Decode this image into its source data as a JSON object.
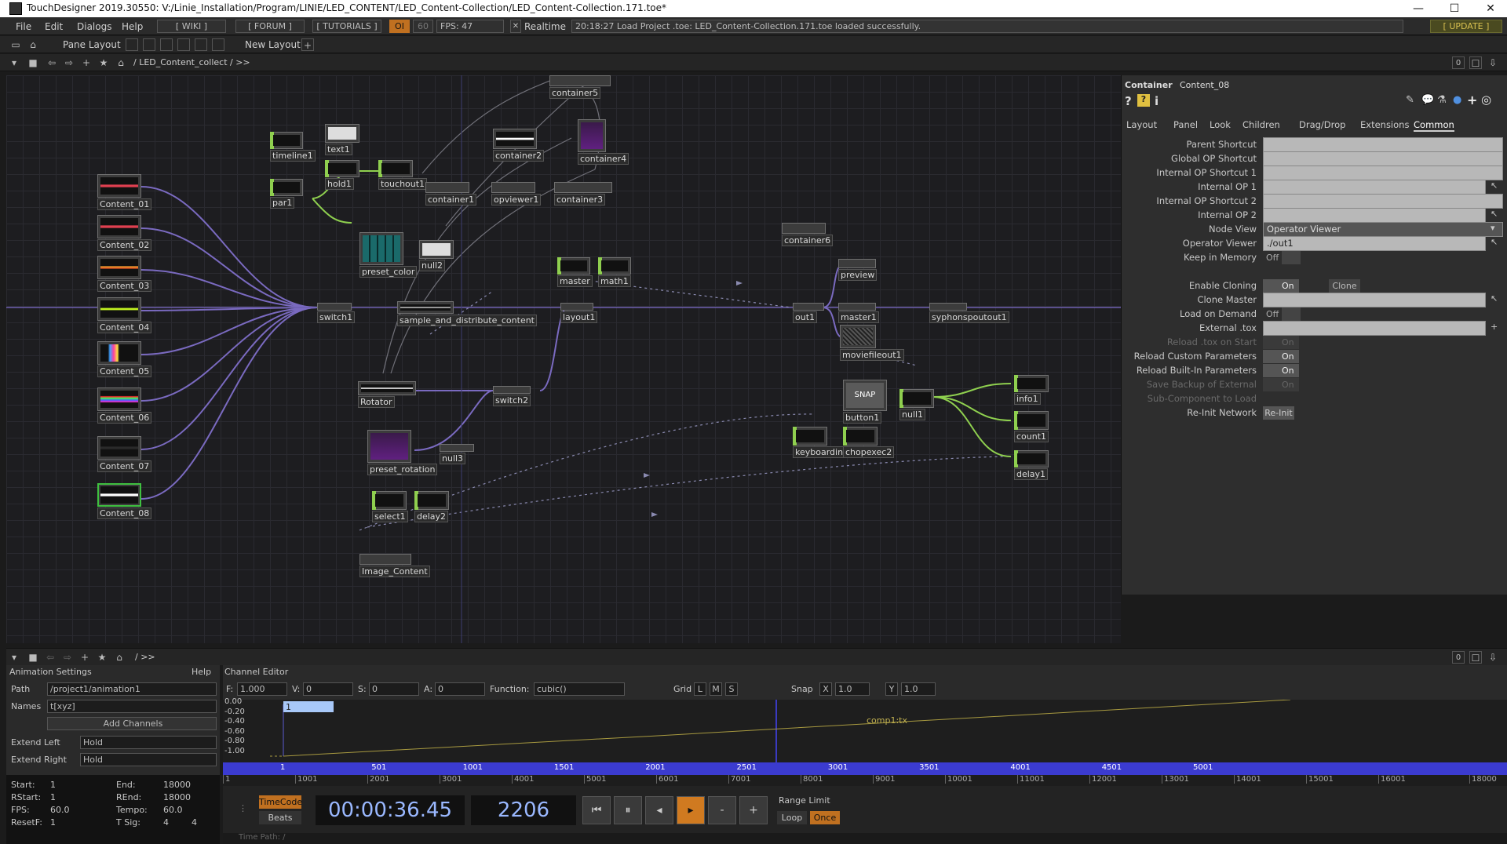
{
  "window": {
    "title": "TouchDesigner 2019.30550: V:/Linie_Installation/Program/LINIE/LED_CONTENT/LED_Content-Collection/LED_Content-Collection.171.toe*",
    "minimize": "—",
    "maximize": "☐",
    "close": "✕"
  },
  "menu": {
    "items": [
      "File",
      "Edit",
      "Dialogs",
      "Help"
    ],
    "wiki": "[ WIKI ]",
    "forum": "[ FORUM ]",
    "tutorials": "[ TUTORIALS ]",
    "oi": "OI",
    "fps_target": "60",
    "fps": "FPS: 47",
    "realtime_check": "✕",
    "realtime": "Realtime",
    "status": "20:18:27 Load Project .toe: LED_Content-Collection.171.toe loaded successfully.",
    "update": "[ UPDATE ]"
  },
  "toolbar": {
    "pane_layout": "Pane Layout",
    "new_layout": "New Layout",
    "plus": "+"
  },
  "pathbar": {
    "path": "/ LED_Content_collect / >>",
    "zero": "0"
  },
  "nodes": [
    {
      "id": "Content_01",
      "label": "Content_01"
    },
    {
      "id": "Content_02",
      "label": "Content_02"
    },
    {
      "id": "Content_03",
      "label": "Content_03"
    },
    {
      "id": "Content_04",
      "label": "Content_04"
    },
    {
      "id": "Content_05",
      "label": "Content_05"
    },
    {
      "id": "Content_06",
      "label": "Content_06"
    },
    {
      "id": "Content_07",
      "label": "Content_07"
    },
    {
      "id": "Content_08",
      "label": "Content_08"
    },
    {
      "id": "timeline1",
      "label": "timeline1"
    },
    {
      "id": "text1",
      "label": "text1"
    },
    {
      "id": "hold1",
      "label": "hold1"
    },
    {
      "id": "touchout1",
      "label": "touchout1"
    },
    {
      "id": "par1",
      "label": "par1"
    },
    {
      "id": "container5",
      "label": "container5"
    },
    {
      "id": "container2",
      "label": "container2"
    },
    {
      "id": "container4",
      "label": "container4"
    },
    {
      "id": "container1",
      "label": "container1"
    },
    {
      "id": "opviewer1",
      "label": "opviewer1"
    },
    {
      "id": "container3",
      "label": "container3"
    },
    {
      "id": "preset_color",
      "label": "preset_color"
    },
    {
      "id": "null2",
      "label": "null2"
    },
    {
      "id": "master",
      "label": "master"
    },
    {
      "id": "math1",
      "label": "math1"
    },
    {
      "id": "switch1",
      "label": "switch1"
    },
    {
      "id": "sample",
      "label": "sample_and_distribute_content"
    },
    {
      "id": "layout1",
      "label": "layout1"
    },
    {
      "id": "container6",
      "label": "container6"
    },
    {
      "id": "preview",
      "label": "preview"
    },
    {
      "id": "out1",
      "label": "out1"
    },
    {
      "id": "master1",
      "label": "master1"
    },
    {
      "id": "syphon",
      "label": "syphonspoutout1"
    },
    {
      "id": "moviefileout1",
      "label": "moviefileout1"
    },
    {
      "id": "Rotator",
      "label": "Rotator"
    },
    {
      "id": "switch2",
      "label": "switch2"
    },
    {
      "id": "preset_rotation",
      "label": "preset_rotation"
    },
    {
      "id": "null3",
      "label": "null3"
    },
    {
      "id": "select1",
      "label": "select1"
    },
    {
      "id": "delay2",
      "label": "delay2"
    },
    {
      "id": "button1",
      "label": "button1",
      "snap": "SNAP"
    },
    {
      "id": "null1",
      "label": "null1"
    },
    {
      "id": "info1",
      "label": "info1"
    },
    {
      "id": "count1",
      "label": "count1"
    },
    {
      "id": "keyboardin",
      "label": "keyboardin1"
    },
    {
      "id": "chopexec2",
      "label": "chopexec2"
    },
    {
      "id": "delay1",
      "label": "delay1"
    },
    {
      "id": "Image_Content",
      "label": "Image_Content"
    }
  ],
  "params": {
    "type": "Container",
    "name": "Content_08",
    "tabs": [
      "Layout",
      "Panel",
      "Look",
      "Children",
      "Drag/Drop",
      "Extensions",
      "Common"
    ],
    "rows": [
      {
        "label": "Parent Shortcut",
        "kind": "field",
        "value": ""
      },
      {
        "label": "Global OP Shortcut",
        "kind": "field",
        "value": ""
      },
      {
        "label": "Internal OP Shortcut 1",
        "kind": "field",
        "value": ""
      },
      {
        "label": "Internal OP 1",
        "kind": "fieldarrow",
        "value": ""
      },
      {
        "label": "Internal OP Shortcut 2",
        "kind": "field",
        "value": ""
      },
      {
        "label": "Internal OP 2",
        "kind": "fieldarrow",
        "value": ""
      },
      {
        "label": "Node View",
        "kind": "menu",
        "value": "Operator Viewer"
      },
      {
        "label": "Operator Viewer",
        "kind": "fieldarrow",
        "value": "./out1"
      },
      {
        "label": "Keep in Memory",
        "kind": "toggle",
        "value": "Off"
      },
      {
        "label": "",
        "kind": "gap",
        "value": ""
      },
      {
        "label": "Enable Cloning",
        "kind": "toggleon",
        "value": "On",
        "extra": "Clone"
      },
      {
        "label": "Clone Master",
        "kind": "fieldarrow",
        "value": ""
      },
      {
        "label": "Load on Demand",
        "kind": "toggle",
        "value": "Off"
      },
      {
        "label": "External .tox",
        "kind": "fieldplus",
        "value": ""
      },
      {
        "label": "Reload .tox on Start",
        "kind": "dimtoggle",
        "value": "On"
      },
      {
        "label": "Reload Custom Parameters",
        "kind": "toggleon",
        "value": "On"
      },
      {
        "label": "Reload Built-In Parameters",
        "kind": "toggleon",
        "value": "On"
      },
      {
        "label": "Save Backup of External",
        "kind": "dimtoggle",
        "value": "On"
      },
      {
        "label": "Sub-Component to Load",
        "kind": "dim",
        "value": ""
      },
      {
        "label": "Re-Init Network",
        "kind": "button",
        "value": "Re-Init"
      }
    ]
  },
  "bottom": {
    "path": "/ >>",
    "zero": "0"
  },
  "anim": {
    "header": "Animation Settings",
    "help": "Help",
    "path_label": "Path",
    "path": "/project1/animation1",
    "names_label": "Names",
    "names": "t[xyz]",
    "add": "Add Channels",
    "extend_left_label": "Extend Left",
    "extend_left": "Hold",
    "extend_right_label": "Extend Right",
    "extend_right": "Hold"
  },
  "chan": {
    "header": "Channel Editor",
    "f_label": "F:",
    "f": "1.000",
    "v_label": "V:",
    "v": "0",
    "s_label": "S:",
    "s": "0",
    "a_label": "A:",
    "a": "0",
    "function_label": "Function:",
    "function": "cubic()",
    "grid": "Grid",
    "grid_l": "L",
    "grid_m": "M",
    "grid_s": "S",
    "snap": "Snap",
    "snap_x": "X",
    "snap_x_val": "1.0",
    "snap_y": "Y",
    "snap_y_val": "1.0",
    "yticks": [
      "0.00",
      "-0.20",
      "-0.40",
      "-0.60",
      "-0.80",
      "-1.00"
    ],
    "key_label": "1",
    "curve_label": "comp1:tx",
    "frame_ticks": [
      "1",
      "501",
      "1001",
      "1501",
      "2001",
      "2501",
      "3001",
      "3501",
      "4001",
      "4501",
      "5001"
    ],
    "range_ticks": [
      "1",
      "1001",
      "2001",
      "3001",
      "4001",
      "5001",
      "6001",
      "7001",
      "8001",
      "9001",
      "10001",
      "11001",
      "12001",
      "13001",
      "14001",
      "15001",
      "16001",
      "18000"
    ]
  },
  "stats": {
    "start_label": "Start:",
    "start": "1",
    "end_label": "End:",
    "end": "18000",
    "rstart_label": "RStart:",
    "rstart": "1",
    "rend_label": "REnd:",
    "rend": "18000",
    "fps_label": "FPS:",
    "fps": "60.0",
    "tempo_label": "Tempo:",
    "tempo": "60.0",
    "resetf_label": "ResetF:",
    "resetf": "1",
    "tsig_label": "T Sig:",
    "tsig_a": "4",
    "tsig_b": "4"
  },
  "transport": {
    "timecode": "TimeCode",
    "beats": "Beats",
    "time": "00:00:36.45",
    "frame": "2206",
    "range_limit": "Range Limit",
    "loop": "Loop",
    "once": "Once",
    "time_path": "Time Path: /"
  }
}
